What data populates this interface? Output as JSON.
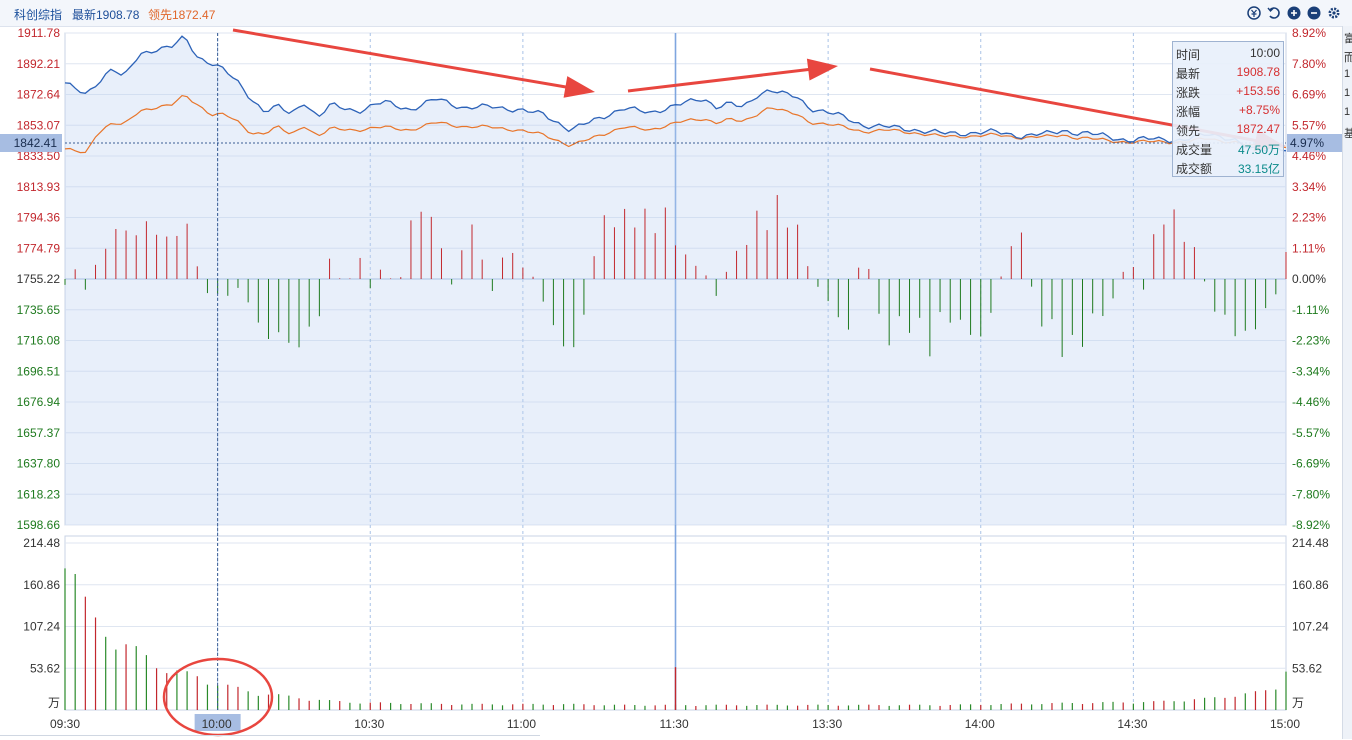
{
  "header": {
    "title": "科创综指",
    "latest": "最新1908.78",
    "lead": "领先1872.47",
    "icons": [
      "coin-icon",
      "undo-icon",
      "zoom-in-icon",
      "zoom-out-icon",
      "gear-icon"
    ]
  },
  "info_box": {
    "rows": [
      {
        "label": "时间",
        "value": "10:00",
        "color": "#333333"
      },
      {
        "label": "最新",
        "value": "1908.78",
        "color": "#d63031"
      },
      {
        "label": "涨跌",
        "value": "+153.56",
        "color": "#d63031"
      },
      {
        "label": "涨幅",
        "value": "+8.75%",
        "color": "#d63031"
      },
      {
        "label": "领先",
        "value": "1872.47",
        "color": "#d63031"
      },
      {
        "label": "成交量",
        "value": "47.50万",
        "color": "#0a8a8a"
      },
      {
        "label": "成交额",
        "value": "33.15亿",
        "color": "#0a8a8a"
      }
    ]
  },
  "right_strip": {
    "chars": [
      "富",
      "而",
      "1",
      "1",
      "1",
      "基"
    ]
  },
  "chart_data": {
    "type": "line",
    "x_ticks": [
      "09:30",
      "10:00",
      "10:30",
      "11:00",
      "11:30",
      "13:30",
      "14:00",
      "14:30",
      "15:00"
    ],
    "crosshair_time": "10:00",
    "crosshair_price": "1842.41",
    "crosshair_pct": "4.97%",
    "price_axis": {
      "labels": [
        "1911.78",
        "1892.21",
        "1872.64",
        "1853.07",
        "1833.50",
        "1813.93",
        "1794.36",
        "1774.79",
        "1755.22",
        "1735.65",
        "1716.08",
        "1696.51",
        "1676.94",
        "1657.37",
        "1637.80",
        "1618.23",
        "1598.66"
      ],
      "ylim": [
        1598.66,
        1911.78
      ],
      "base": 1755.22
    },
    "pct_axis": {
      "labels": [
        "8.92%",
        "7.80%",
        "6.69%",
        "5.57%",
        "4.46%",
        "3.34%",
        "2.23%",
        "1.11%",
        "0.00%",
        "-1.11%",
        "-2.23%",
        "-3.34%",
        "-4.46%",
        "-5.57%",
        "-6.69%",
        "-7.80%",
        "-8.92%"
      ]
    },
    "volume_axis": {
      "labels": [
        "214.48",
        "160.86",
        "107.24",
        "53.62"
      ],
      "unit": "万",
      "ylim": [
        0,
        214.48
      ]
    },
    "series": [
      {
        "name": "最新",
        "color": "#2c62b8",
        "keypoints": [
          [
            0,
            1880
          ],
          [
            8,
            1872
          ],
          [
            12,
            1880
          ],
          [
            18,
            1890
          ],
          [
            22,
            1883
          ],
          [
            28,
            1898
          ],
          [
            35,
            1902
          ],
          [
            40,
            1903
          ],
          [
            45,
            1909
          ],
          [
            50,
            1896
          ],
          [
            55,
            1893
          ],
          [
            60,
            1888
          ],
          [
            65,
            1880
          ],
          [
            70,
            1870
          ],
          [
            75,
            1862
          ],
          [
            80,
            1865
          ],
          [
            85,
            1860
          ],
          [
            90,
            1868
          ],
          [
            95,
            1858
          ],
          [
            100,
            1866
          ],
          [
            110,
            1862
          ],
          [
            120,
            1868
          ],
          [
            130,
            1863
          ],
          [
            140,
            1870
          ],
          [
            150,
            1864
          ],
          [
            160,
            1865
          ],
          [
            170,
            1863
          ],
          [
            180,
            1860
          ],
          [
            190,
            1850
          ],
          [
            200,
            1857
          ],
          [
            210,
            1864
          ],
          [
            220,
            1861
          ],
          [
            230,
            1866
          ],
          [
            240,
            1870
          ],
          [
            245,
            1865
          ],
          [
            250,
            1867
          ],
          [
            255,
            1864
          ],
          [
            260,
            1872
          ],
          [
            265,
            1876
          ],
          [
            270,
            1873
          ],
          [
            275,
            1871
          ],
          [
            280,
            1864
          ],
          [
            290,
            1860
          ],
          [
            300,
            1853
          ],
          [
            310,
            1852
          ],
          [
            320,
            1850
          ],
          [
            330,
            1848
          ],
          [
            340,
            1848
          ],
          [
            350,
            1849
          ],
          [
            360,
            1846
          ],
          [
            370,
            1848
          ],
          [
            375,
            1850
          ],
          [
            380,
            1848
          ],
          [
            390,
            1847
          ],
          [
            400,
            1843
          ],
          [
            410,
            1845
          ],
          [
            420,
            1843
          ],
          [
            430,
            1848
          ],
          [
            435,
            1846
          ],
          [
            440,
            1843
          ],
          [
            445,
            1838
          ],
          [
            450,
            1838
          ],
          [
            455,
            1840
          ],
          [
            459,
            1837
          ]
        ]
      },
      {
        "name": "领先",
        "color": "#e8752a",
        "keypoints": [
          [
            0,
            1838
          ],
          [
            8,
            1835
          ],
          [
            12,
            1848
          ],
          [
            18,
            1855
          ],
          [
            22,
            1853
          ],
          [
            28,
            1862
          ],
          [
            35,
            1865
          ],
          [
            40,
            1866
          ],
          [
            45,
            1872
          ],
          [
            50,
            1866
          ],
          [
            55,
            1860
          ],
          [
            60,
            1860
          ],
          [
            65,
            1855
          ],
          [
            70,
            1848
          ],
          [
            75,
            1848
          ],
          [
            80,
            1852
          ],
          [
            85,
            1847
          ],
          [
            90,
            1853
          ],
          [
            95,
            1846
          ],
          [
            100,
            1851
          ],
          [
            110,
            1850
          ],
          [
            120,
            1852
          ],
          [
            130,
            1850
          ],
          [
            140,
            1855
          ],
          [
            150,
            1852
          ],
          [
            160,
            1852
          ],
          [
            170,
            1850
          ],
          [
            180,
            1847
          ],
          [
            190,
            1840
          ],
          [
            200,
            1846
          ],
          [
            210,
            1852
          ],
          [
            220,
            1850
          ],
          [
            230,
            1855
          ],
          [
            240,
            1857
          ],
          [
            245,
            1855
          ],
          [
            250,
            1857
          ],
          [
            255,
            1855
          ],
          [
            260,
            1860
          ],
          [
            265,
            1865
          ],
          [
            270,
            1862
          ],
          [
            275,
            1860
          ],
          [
            280,
            1855
          ],
          [
            290,
            1853
          ],
          [
            300,
            1849
          ],
          [
            310,
            1850
          ],
          [
            320,
            1848
          ],
          [
            330,
            1846
          ],
          [
            340,
            1846
          ],
          [
            350,
            1847
          ],
          [
            360,
            1845
          ],
          [
            370,
            1846
          ],
          [
            375,
            1847
          ],
          [
            380,
            1845
          ],
          [
            390,
            1844
          ],
          [
            400,
            1842
          ],
          [
            410,
            1843
          ],
          [
            420,
            1842
          ],
          [
            430,
            1845
          ],
          [
            435,
            1843
          ],
          [
            440,
            1842
          ],
          [
            445,
            1840
          ],
          [
            450,
            1840
          ],
          [
            455,
            1841
          ],
          [
            459,
            1839
          ]
        ]
      }
    ],
    "bars_keypoints": [
      [
        0,
        -5
      ],
      [
        5,
        8
      ],
      [
        8,
        -10
      ],
      [
        12,
        10
      ],
      [
        17,
        25
      ],
      [
        22,
        30
      ],
      [
        27,
        25
      ],
      [
        32,
        35
      ],
      [
        37,
        20
      ],
      [
        42,
        30
      ],
      [
        47,
        28
      ],
      [
        52,
        -5
      ],
      [
        57,
        -12
      ],
      [
        62,
        -8
      ],
      [
        67,
        -5
      ],
      [
        72,
        -25
      ],
      [
        75,
        -35
      ],
      [
        80,
        -30
      ],
      [
        85,
        -40
      ],
      [
        90,
        -35
      ],
      [
        95,
        -25
      ],
      [
        100,
        20
      ],
      [
        105,
        -10
      ],
      [
        110,
        15
      ],
      [
        115,
        -8
      ],
      [
        120,
        10
      ],
      [
        125,
        -10
      ],
      [
        130,
        35
      ],
      [
        135,
        40
      ],
      [
        140,
        30
      ],
      [
        145,
        -5
      ],
      [
        150,
        25
      ],
      [
        155,
        30
      ],
      [
        160,
        -10
      ],
      [
        165,
        20
      ],
      [
        170,
        10
      ],
      [
        175,
        5
      ],
      [
        180,
        -15
      ],
      [
        185,
        -30
      ],
      [
        190,
        -48
      ],
      [
        195,
        -20
      ],
      [
        200,
        25
      ],
      [
        205,
        40
      ],
      [
        210,
        35
      ],
      [
        215,
        45
      ],
      [
        220,
        30
      ],
      [
        225,
        40
      ],
      [
        230,
        20
      ],
      [
        235,
        10
      ],
      [
        240,
        5
      ],
      [
        245,
        -10
      ],
      [
        250,
        10
      ],
      [
        255,
        20
      ],
      [
        260,
        35
      ],
      [
        265,
        40
      ],
      [
        270,
        45
      ],
      [
        275,
        30
      ],
      [
        280,
        5
      ],
      [
        285,
        -10
      ],
      [
        290,
        -20
      ],
      [
        295,
        -30
      ],
      [
        300,
        25
      ],
      [
        305,
        -20
      ],
      [
        310,
        -35
      ],
      [
        315,
        -25
      ],
      [
        320,
        -30
      ],
      [
        325,
        -40
      ],
      [
        330,
        -20
      ],
      [
        335,
        -25
      ],
      [
        340,
        -30
      ],
      [
        345,
        -35
      ],
      [
        350,
        -10
      ],
      [
        355,
        20
      ],
      [
        360,
        25
      ],
      [
        365,
        -20
      ],
      [
        370,
        -30
      ],
      [
        375,
        -40
      ],
      [
        380,
        -45
      ],
      [
        385,
        -25
      ],
      [
        390,
        -20
      ],
      [
        395,
        -10
      ],
      [
        400,
        15
      ],
      [
        405,
        -10
      ],
      [
        410,
        30
      ],
      [
        415,
        40
      ],
      [
        420,
        30
      ],
      [
        425,
        15
      ],
      [
        430,
        -10
      ],
      [
        435,
        -25
      ],
      [
        440,
        -30
      ],
      [
        445,
        -35
      ],
      [
        450,
        -20
      ],
      [
        455,
        -10
      ],
      [
        459,
        15
      ]
    ],
    "volume_keypoints": [
      [
        0,
        214
      ],
      [
        3,
        180
      ],
      [
        6,
        140
      ],
      [
        10,
        110
      ],
      [
        15,
        95
      ],
      [
        20,
        85
      ],
      [
        25,
        75
      ],
      [
        30,
        65
      ],
      [
        35,
        55
      ],
      [
        40,
        48
      ],
      [
        45,
        44
      ],
      [
        50,
        40
      ],
      [
        55,
        34
      ],
      [
        60,
        30
      ],
      [
        65,
        26
      ],
      [
        70,
        22
      ],
      [
        80,
        18
      ],
      [
        90,
        14
      ],
      [
        100,
        11
      ],
      [
        110,
        9
      ],
      [
        130,
        8
      ],
      [
        150,
        7
      ],
      [
        170,
        7
      ],
      [
        190,
        7
      ],
      [
        210,
        6
      ],
      [
        230,
        6
      ],
      [
        250,
        6
      ],
      [
        270,
        6
      ],
      [
        290,
        6
      ],
      [
        310,
        6
      ],
      [
        330,
        6
      ],
      [
        350,
        7
      ],
      [
        370,
        8
      ],
      [
        390,
        9
      ],
      [
        410,
        10
      ],
      [
        420,
        12
      ],
      [
        430,
        14
      ],
      [
        440,
        18
      ],
      [
        450,
        22
      ],
      [
        455,
        28
      ],
      [
        459,
        50
      ]
    ],
    "volume_spikes": [
      [
        230,
        55
      ]
    ]
  }
}
